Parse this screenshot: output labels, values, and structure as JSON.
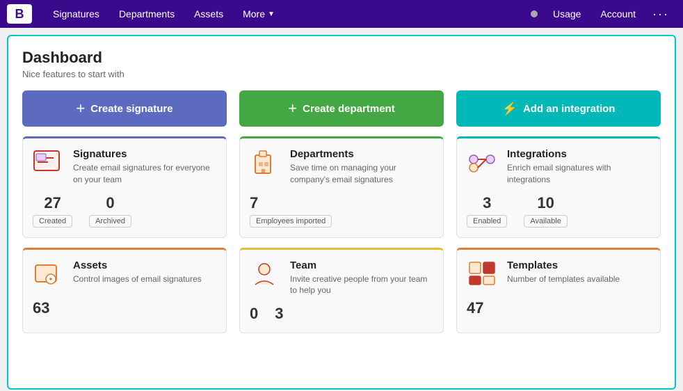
{
  "navbar": {
    "logo": "B",
    "links": [
      {
        "label": "Signatures",
        "name": "nav-signatures"
      },
      {
        "label": "Departments",
        "name": "nav-departments"
      },
      {
        "label": "Assets",
        "name": "nav-assets"
      },
      {
        "label": "More",
        "name": "nav-more",
        "hasChevron": true
      }
    ],
    "right": [
      {
        "label": "Usage",
        "name": "nav-usage"
      },
      {
        "label": "Account",
        "name": "nav-account"
      }
    ],
    "moreDots": "···"
  },
  "dashboard": {
    "title": "Dashboard",
    "subtitle": "Nice features to start with"
  },
  "actions": [
    {
      "label": "Create signature",
      "icon": "+",
      "style": "btn-blue",
      "name": "create-signature-btn"
    },
    {
      "label": "Create department",
      "icon": "+",
      "style": "btn-green",
      "name": "create-department-btn"
    },
    {
      "label": "Add an integration",
      "icon": "⚡",
      "style": "btn-teal",
      "name": "add-integration-btn"
    }
  ],
  "cards": [
    {
      "name": "signatures-card",
      "title": "Signatures",
      "desc": "Create email signatures for everyone on your team",
      "accentClass": "card-signatures",
      "stats": [
        {
          "num": "27",
          "badge": "Created"
        },
        {
          "num": "0",
          "badge": "Archived"
        }
      ]
    },
    {
      "name": "departments-card",
      "title": "Departments",
      "desc": "Save time on managing your company's email signatures",
      "accentClass": "card-departments",
      "singleStat": {
        "num": "7",
        "badge": "Employees imported"
      }
    },
    {
      "name": "integrations-card",
      "title": "Integrations",
      "desc": "Enrich email signatures with integrations",
      "accentClass": "card-integrations",
      "stats": [
        {
          "num": "3",
          "badge": "Enabled"
        },
        {
          "num": "10",
          "badge": "Available"
        }
      ]
    }
  ],
  "cards2": [
    {
      "name": "assets-card",
      "title": "Assets",
      "desc": "Control images of email signatures",
      "accentClass": "card-assets",
      "singleStat": {
        "num": "63",
        "badge": ""
      }
    },
    {
      "name": "team-card",
      "title": "Team",
      "desc": "Invite creative people from your team to help you",
      "accentClass": "card-team",
      "stats": [
        {
          "num": "0",
          "badge": ""
        },
        {
          "num": "3",
          "badge": ""
        }
      ]
    },
    {
      "name": "templates-card",
      "title": "Templates",
      "desc": "Number of templates available",
      "accentClass": "card-templates",
      "singleStat": {
        "num": "47",
        "badge": ""
      }
    }
  ]
}
